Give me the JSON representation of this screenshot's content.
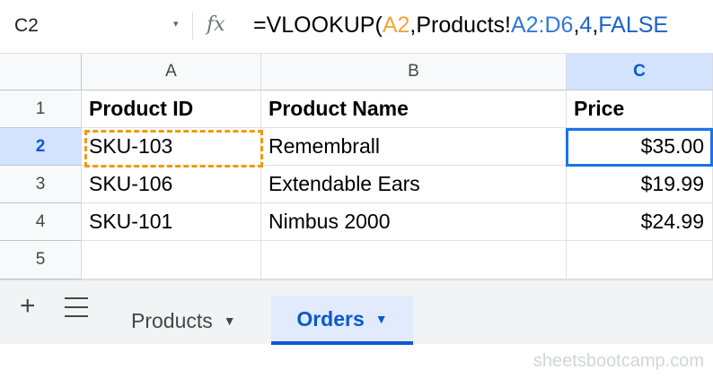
{
  "formula_bar": {
    "name_box": "C2",
    "name_box_arrow": "▾",
    "fx_label": "fx",
    "formula_parts": [
      "=VLOOKUP(",
      "A2",
      ",Products!",
      "A2:D6",
      ",",
      "4",
      ",",
      "FALSE"
    ]
  },
  "grid": {
    "columns": [
      "A",
      "B",
      "C"
    ],
    "active_column": "C",
    "row_numbers": [
      "1",
      "2",
      "3",
      "4",
      "5"
    ],
    "active_row": "2",
    "rows": [
      [
        "Product ID",
        "Product Name",
        "Price"
      ],
      [
        "SKU-103",
        "Remembrall",
        "$35.00"
      ],
      [
        "SKU-106",
        "Extendable Ears",
        "$19.99"
      ],
      [
        "SKU-101",
        "Nimbus 2000",
        "$24.99"
      ],
      [
        "",
        "",
        ""
      ]
    ],
    "selected_cell": "C2",
    "copy_cell": "A2"
  },
  "tabs": {
    "add_label": "+",
    "items": [
      {
        "label": "Products",
        "arrow": "▼",
        "active": false
      },
      {
        "label": "Orders",
        "arrow": "▼",
        "active": true
      }
    ]
  },
  "watermark": "sheetsbootcamp.com",
  "colors": {
    "accent": "#0b57d0",
    "copy_border": "#f29900",
    "reference_orange": "#f4a53a",
    "reference_blue": "#2f7ad8"
  }
}
